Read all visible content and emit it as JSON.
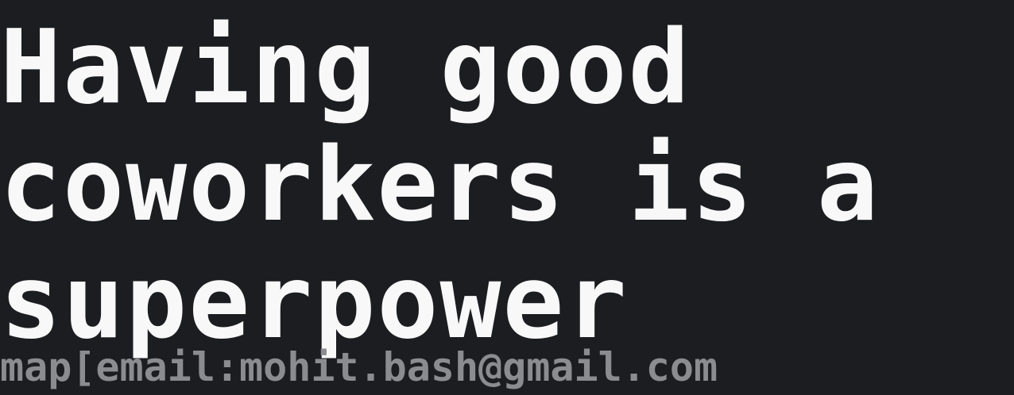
{
  "title": "Having good\ncoworkers is a\nsuperpower",
  "author_line": "map[email:mohit.bash@gmail.com",
  "colors": {
    "background": "#1c1d21",
    "title": "#f8f8f8",
    "author": "#8b8c90"
  }
}
